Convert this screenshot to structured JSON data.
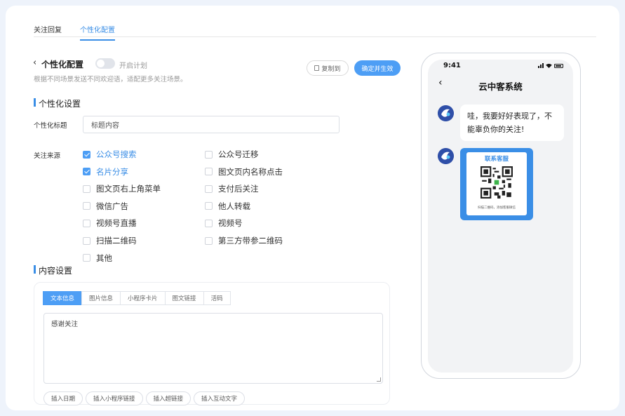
{
  "top_tabs": [
    {
      "label": "关注回复",
      "active": false
    },
    {
      "label": "个性化配置",
      "active": true
    }
  ],
  "header": {
    "title": "个性化配置",
    "toggle_label": "开启计划",
    "toggle_on": false,
    "subtitle": "根据不同场景发送不同欢迎语，适配更多关注场景。",
    "copy_button": "复制到",
    "confirm_button": "确定并生效"
  },
  "personalize": {
    "section_title": "个性化设置",
    "title_label": "个性化标题",
    "title_value": "标题内容",
    "source_label": "关注来源",
    "sources": [
      {
        "label": "公众号搜索",
        "checked": true
      },
      {
        "label": "公众号迁移",
        "checked": false
      },
      {
        "label": "名片分享",
        "checked": true
      },
      {
        "label": "图文页内名称点击",
        "checked": false
      },
      {
        "label": "图文页右上角菜单",
        "checked": false
      },
      {
        "label": "支付后关注",
        "checked": false
      },
      {
        "label": "微信广告",
        "checked": false
      },
      {
        "label": "他人转载",
        "checked": false
      },
      {
        "label": "视频号直播",
        "checked": false
      },
      {
        "label": "视频号",
        "checked": false
      },
      {
        "label": "扫描二维码",
        "checked": false
      },
      {
        "label": "第三方带参二维码",
        "checked": false
      },
      {
        "label": "其他",
        "checked": false
      }
    ]
  },
  "content": {
    "section_title": "内容设置",
    "tabs": [
      {
        "label": "文本信息",
        "active": true
      },
      {
        "label": "图片信息",
        "active": false
      },
      {
        "label": "小程序卡片",
        "active": false
      },
      {
        "label": "图文链接",
        "active": false
      },
      {
        "label": "活码",
        "active": false
      }
    ],
    "text_value": "感谢关注",
    "insert_buttons": [
      "插入日期",
      "插入小程序链接",
      "插入超链接",
      "插入互动文字"
    ]
  },
  "phone": {
    "time": "9:41",
    "title": "云中客系统",
    "message": "哇，我要好好表现了，不能辜负你的关注!",
    "qr_header": "联系客服",
    "qr_footer": "扫描二维码，添加客服微信"
  },
  "colors": {
    "accent": "#3a8ee6",
    "button_blue": "#4d9ef5",
    "background": "#eef3fb"
  }
}
